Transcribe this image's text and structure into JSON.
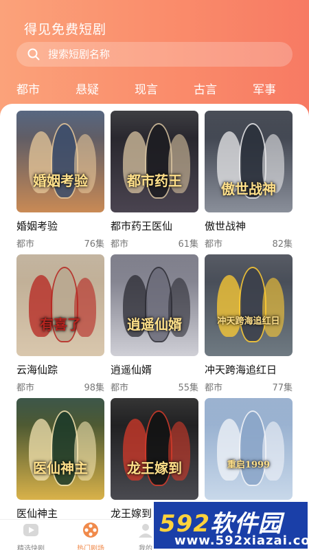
{
  "app": {
    "title": "得见免费短剧"
  },
  "search": {
    "placeholder": "搜索短剧名称"
  },
  "tabs": [
    {
      "label": "都市"
    },
    {
      "label": "悬疑"
    },
    {
      "label": "现言"
    },
    {
      "label": "古言"
    },
    {
      "label": "军事"
    }
  ],
  "dramas": [
    {
      "title": "婚姻考验",
      "poster_text": "婚姻考验",
      "genre": "都市",
      "episodes": "76集",
      "colors": [
        "#3b4d6b",
        "#c98a55",
        "#e6c79a"
      ]
    },
    {
      "title": "都市药王医仙",
      "poster_text": "都市药王",
      "genre": "都市",
      "episodes": "61集",
      "colors": [
        "#1d1d22",
        "#4a4450",
        "#d8c3a0"
      ]
    },
    {
      "title": "傲世战神",
      "poster_text": "傲世战神",
      "genre": "都市",
      "episodes": "82集",
      "colors": [
        "#2a2f3a",
        "#8a8f9a",
        "#e8e8ea"
      ]
    },
    {
      "title": "云海仙踪",
      "poster_text": "有喜了",
      "genre": "都市",
      "episodes": "98集",
      "colors": [
        "#b9a890",
        "#d9c7ad",
        "#b5241f"
      ]
    },
    {
      "title": "逍遥仙婿",
      "poster_text": "逍遥仙婿",
      "genre": "都市",
      "episodes": "55集",
      "colors": [
        "#6a6a78",
        "#cfcfd6",
        "#2b2b33"
      ]
    },
    {
      "title": "冲天跨海追红日",
      "poster_text": "冲天跨海追红日",
      "genre": "都市",
      "episodes": "77集",
      "colors": [
        "#3b3f4a",
        "#6f7a82",
        "#ffcc33"
      ]
    },
    {
      "title": "医仙神主",
      "poster_text": "医仙神主",
      "genre": "",
      "episodes": "",
      "colors": [
        "#1c3a2a",
        "#d9b24a",
        "#f2e2b0"
      ]
    },
    {
      "title": "龙王嫁到",
      "poster_text": "龙王嫁到",
      "genre": "",
      "episodes": "",
      "colors": [
        "#121212",
        "#4a4a50",
        "#d43a2a"
      ]
    },
    {
      "title": "",
      "poster_text": "重启1999",
      "genre": "",
      "episodes": "",
      "colors": [
        "#8aa5c8",
        "#c8d8ea",
        "#f2f4f8"
      ]
    }
  ],
  "bottom_nav": [
    {
      "label": "精选快剧",
      "icon": "play-icon",
      "active": false
    },
    {
      "label": "热门剧场",
      "icon": "film-reel-icon",
      "active": true
    },
    {
      "label": "我的",
      "icon": "user-icon",
      "active": false
    }
  ],
  "watermark": {
    "brand_num": "592",
    "brand_text": "软件园",
    "url": "www.592xiazai.com"
  },
  "colors": {
    "accent": "#f77a63",
    "header_start": "#fba27a",
    "active_nav": "#f08a4b"
  }
}
